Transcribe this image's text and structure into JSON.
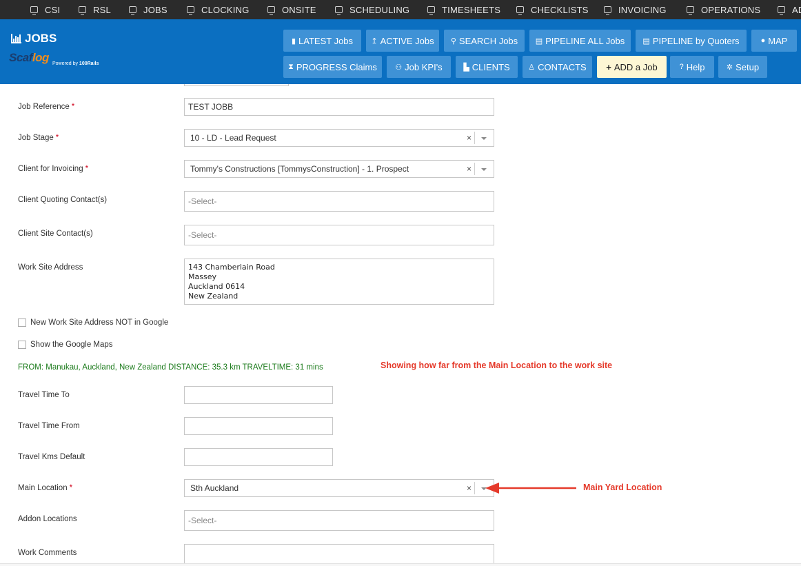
{
  "topnav": {
    "items": [
      {
        "label": "CSI",
        "icon": "gear-icon"
      },
      {
        "label": "RSL",
        "icon": "box-icon"
      },
      {
        "label": "JOBS",
        "icon": "monitor-icon"
      },
      {
        "label": "CLOCKING",
        "icon": "monitor-icon"
      },
      {
        "label": "ONSITE",
        "icon": "box-icon"
      },
      {
        "label": "SCHEDULING",
        "icon": "monitor-icon"
      },
      {
        "label": "TIMESHEETS",
        "icon": "monitor-icon"
      },
      {
        "label": "CHECKLISTS",
        "icon": "monitor-icon"
      },
      {
        "label": "INVOICING",
        "icon": "box-icon"
      },
      {
        "label": "OPERATIONS",
        "icon": "monitor-icon"
      },
      {
        "label": "AD",
        "icon": "box-icon"
      }
    ]
  },
  "header": {
    "title": "JOBS",
    "logo_text": "Scaflog",
    "powered_prefix": "Powered by ",
    "powered_brand": "100Rails",
    "buttons_row1": [
      {
        "label": "LATEST Jobs",
        "icon": "book-icon"
      },
      {
        "label": "ACTIVE Jobs",
        "icon": "arrow-up-icon"
      },
      {
        "label": "SEARCH Jobs",
        "icon": "search-icon"
      },
      {
        "label": "PIPELINE ALL Jobs",
        "icon": "list-icon"
      },
      {
        "label": "PIPELINE by Quoters",
        "icon": "list-icon"
      },
      {
        "label": "MAP",
        "icon": "globe-icon"
      }
    ],
    "buttons_row2": [
      {
        "label": "PROGRESS Claims",
        "icon": "hourglass-icon"
      },
      {
        "label": "Job KPI's",
        "icon": "gauge-icon"
      },
      {
        "label": "CLIENTS",
        "icon": "factory-icon"
      },
      {
        "label": "CONTACTS",
        "icon": "person-icon"
      },
      {
        "label": "ADD a Job",
        "icon": "plus-icon"
      },
      {
        "label": "Help",
        "icon": "question-icon"
      },
      {
        "label": "Setup",
        "icon": "cog-icon"
      }
    ]
  },
  "form": {
    "job_reference": {
      "label": "Job Reference",
      "value": "TEST JOBB"
    },
    "job_stage": {
      "label": "Job Stage",
      "value": "10 - LD - Lead Request"
    },
    "client_invoicing": {
      "label": "Client for Invoicing",
      "value": "Tommy's Constructions [TommysConstruction] - 1. Prospect"
    },
    "client_quoting": {
      "label": "Client Quoting Contact(s)",
      "placeholder": "-Select-"
    },
    "client_site": {
      "label": "Client Site Contact(s)",
      "placeholder": "-Select-"
    },
    "work_site": {
      "label": "Work Site Address",
      "lines": [
        "143 Chamberlain Road",
        "Massey",
        "Auckland 0614",
        "New Zealand"
      ]
    },
    "chk_not_in_google": "New Work Site Address NOT in Google",
    "chk_show_maps": "Show the Google Maps",
    "distance_text": "FROM: Manukau, Auckland, New Zealand DISTANCE: 35.3 km TRAVELTIME: 31 mins",
    "travel_to": {
      "label": "Travel Time To",
      "value": ""
    },
    "travel_from": {
      "label": "Travel Time From",
      "value": ""
    },
    "travel_kms": {
      "label": "Travel Kms Default",
      "value": ""
    },
    "main_location": {
      "label": "Main Location",
      "value": "Sth Auckland"
    },
    "addon_locations": {
      "label": "Addon Locations",
      "placeholder": "-Select-"
    },
    "work_comments": {
      "label": "Work Comments",
      "value": ""
    },
    "required_mark": "*",
    "clear_glyph": "×"
  },
  "annotations": {
    "distance_note": "Showing how far from the Main Location to the work site",
    "main_yard_note": "Main Yard Location"
  },
  "colors": {
    "header_blue": "#0b6fc1",
    "button_blue": "#3f92d6",
    "active_button": "#fdf7d4",
    "annotation_red": "#e53a2b",
    "distance_green": "#1a7a1a"
  }
}
